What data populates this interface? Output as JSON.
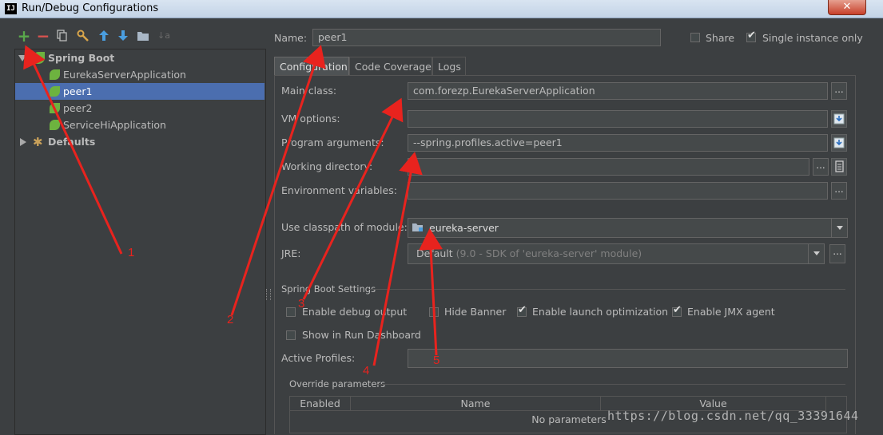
{
  "window": {
    "title": "Run/Debug Configurations",
    "app_icon_text": "IJ",
    "close_glyph": "✕"
  },
  "toolbar": {
    "icons": [
      "add-icon",
      "remove-icon",
      "copy-icon",
      "wrench-icon",
      "move-up-icon",
      "move-down-icon",
      "folder-icon",
      "sort-icon"
    ],
    "add_glyph": "+",
    "remove_glyph": "−",
    "up_glyph": "🡅",
    "down_glyph": "🡇",
    "sort_glyph": "↓a"
  },
  "tree": {
    "group": "Spring Boot",
    "items": [
      "EurekaServerApplication",
      "peer1",
      "peer2",
      "ServiceHiApplication"
    ],
    "selected": "peer1",
    "defaults": "Defaults"
  },
  "header": {
    "name_label": "Name:",
    "name_value": "peer1",
    "share_label": "Share",
    "share_checked": false,
    "single_instance_label": "Single instance only",
    "single_instance_checked": true
  },
  "tabs": [
    {
      "label": "Configuration",
      "active": true
    },
    {
      "label": "Code Coverage",
      "active": false
    },
    {
      "label": "Logs",
      "active": false
    }
  ],
  "form": {
    "main_class_label": "Main class:",
    "main_class_value": "com.forezp.EurekaServerApplication",
    "vm_options_label": "VM options:",
    "vm_options_value": "",
    "program_args_label": "Program arguments:",
    "program_args_value": "--spring.profiles.active=peer1",
    "working_dir_label": "Working directory:",
    "working_dir_value": "",
    "env_vars_label": "Environment variables:",
    "env_vars_value": "",
    "classpath_label": "Use classpath of module:",
    "classpath_value": "eureka-server",
    "jre_label": "JRE:",
    "jre_value": "Default",
    "jre_detail": "(9.0 - SDK of 'eureka-server' module)",
    "ellipsis": "..."
  },
  "spring_boot_settings": {
    "title": "Spring Boot Settings",
    "enable_debug_output": {
      "label": "Enable debug output",
      "checked": false
    },
    "hide_banner": {
      "label": "Hide Banner",
      "checked": false
    },
    "enable_launch_optimization": {
      "label": "Enable launch optimization",
      "checked": true
    },
    "enable_jmx_agent": {
      "label": "Enable JMX agent",
      "checked": true
    },
    "show_in_run_dashboard": {
      "label": "Show in Run Dashboard",
      "checked": false
    },
    "active_profiles_label": "Active Profiles:",
    "active_profiles_value": ""
  },
  "override": {
    "title": "Override parameters",
    "columns": [
      "Enabled",
      "Name",
      "Value"
    ],
    "empty_text": "No parameters"
  },
  "annotations": {
    "labels": [
      "1",
      "2",
      "3",
      "4",
      "5"
    ],
    "color": "#e8231e"
  },
  "watermark": "https://blog.csdn.net/qq_33391644",
  "colors": {
    "background": "#3c3f41",
    "selection": "#4b6eaf",
    "spring_green": "#6db33f",
    "annotation_red": "#e8231e"
  }
}
